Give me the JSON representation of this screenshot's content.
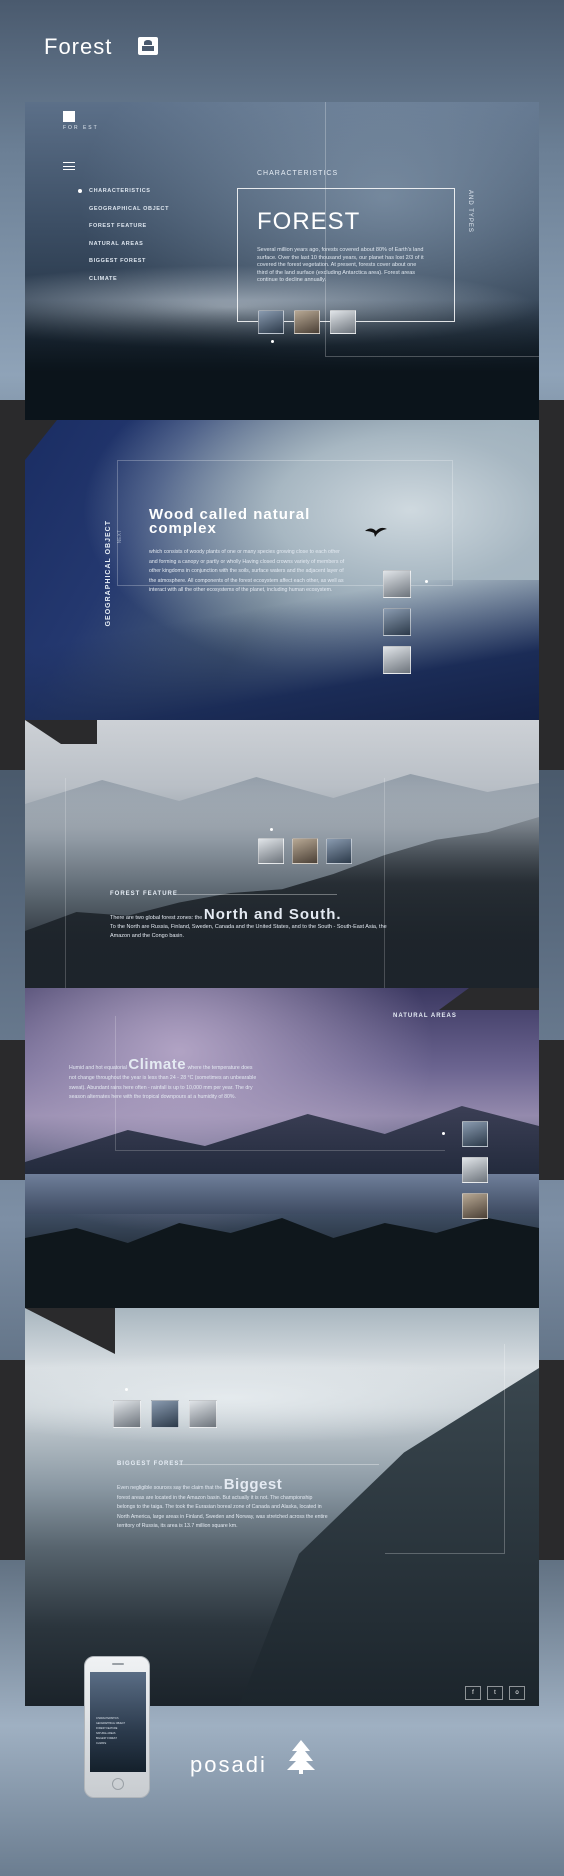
{
  "brand": {
    "title": "Forest"
  },
  "logo": {
    "text": "FOR EST"
  },
  "nav": {
    "items": [
      "CHARACTERISTICS",
      "GEOGRAPHICAL OBJECT",
      "FOREST FEATURE",
      "NATURAL AREAS",
      "BIGGEST FOREST",
      "CLIMATE"
    ]
  },
  "hero": {
    "eyebrow": "CHARACTERISTICS",
    "side_label": "AND TYPES",
    "title": "FOREST",
    "description": "Several million years ago, forests covered about 80% of Earth's land surface. Over the last 10 thousand years, our planet has lost 2/3 of it covered the forest vegetation. At present, forests cover about one third of the land surface (excluding Antarctica area). Forest areas continue to decline annually."
  },
  "geo": {
    "side_label": "GEOGRAPHICAL OBJECT",
    "side_sub": "NEXT",
    "title": "Wood called natural complex",
    "description": "which consists of woody plants of one or many species growing close to each other and forming a canopy or partly or wholly Having closed crowns variety of members of other kingdoms in conjunction with the soils, surface waters and the adjacent layer of the atmosphere. All components of the forest ecosystem affect each other, as well as interact with all the other ecosystems of the planet, including human ecosystem."
  },
  "feature": {
    "label": "FOREST FEATURE",
    "intro": "There are two global forest zones: the",
    "title": "North and South.",
    "description": "To the North are Russia, Finland, Sweden, Canada and the United States, and to the South - South-East Asia, the Amazon and the Congo basin."
  },
  "natural": {
    "label": "NATURAL AREAS",
    "intro": "Humid and hot equatorial",
    "title": "Climate",
    "description": "where the temperature does not change throughout the year is less than 24 - 28 °C (sometimes an unbearable sweat). Abundant rains here often - rainfall is up to 10,000 mm per year. The dry season alternates here with the tropical downpours at a humidity of 80%."
  },
  "biggest": {
    "label": "BIGGEST FOREST",
    "intro": "Even negligible sources say the claim that the",
    "title": "Biggest",
    "description": "forest areas are located in the Amazon basin. But actually it is not. The championship belongs to the taiga. The took the Eurasian boreal zone of Canada and Alaska, located in North America, large areas in Finland, Sweden and Norway, was stretched across the entire territory of Russia, its area is 13.7 million square km."
  },
  "social": {
    "facebook": "f",
    "twitter": "t",
    "instagram": "o"
  },
  "footer": {
    "brand": "posadi"
  },
  "colors": {
    "dark_band": "#2a2a2c",
    "text": "#ffffff"
  }
}
